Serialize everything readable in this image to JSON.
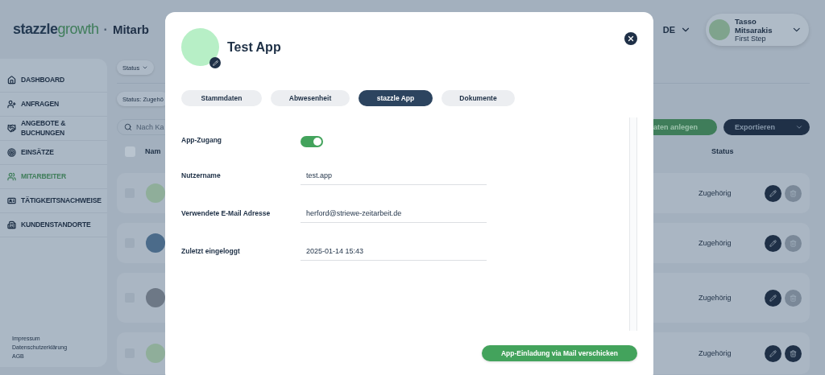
{
  "brand": {
    "name": "stazzle",
    "suffix": "growth"
  },
  "separator": "·",
  "page_title": "Mitarb",
  "language": "DE",
  "user": {
    "name": "Tasso Mitsarakis",
    "company": "First Step"
  },
  "sidebar": {
    "items": [
      {
        "label": "DASHBOARD",
        "selected": false
      },
      {
        "label": "ANFRAGEN",
        "selected": false
      },
      {
        "label": "ANGEBOTE & BUCHUNGEN",
        "selected": false
      },
      {
        "label": "EINSÄTZE",
        "selected": false
      },
      {
        "label": "MITARBEITER",
        "selected": true
      },
      {
        "label": "TÄTIGKEITSNACHWEISE",
        "selected": false
      },
      {
        "label": "KUNDENSTANDORTE",
        "selected": false
      }
    ],
    "footer_links": [
      "Impressum",
      "Datenschutzerklärung",
      "AGB"
    ]
  },
  "filters": {
    "chip": "Status",
    "active_filter": "Status: Zugehö"
  },
  "search": {
    "placeholder": "Nach Ka"
  },
  "actions": {
    "create": "aten anlegen",
    "export": "Exportieren"
  },
  "table": {
    "columns": [
      "Nam",
      "Status"
    ],
    "select_all_checked": false,
    "rows": [
      {
        "checked": false,
        "status": "Zugehörig",
        "delete_enabled": false
      },
      {
        "checked": false,
        "status": "Zugehörig",
        "delete_enabled": false
      },
      {
        "checked": false,
        "status": "Zugehörig",
        "delete_enabled": false
      },
      {
        "checked": false,
        "status": "Zugehörig",
        "delete_enabled": true
      }
    ]
  },
  "modal": {
    "title": "Test App",
    "tabs": [
      {
        "label": "Stammdaten",
        "selected": false
      },
      {
        "label": "Abwesenheit",
        "selected": false
      },
      {
        "label": "stazzle App",
        "selected": true
      },
      {
        "label": "Dokumente",
        "selected": false
      }
    ],
    "fields": [
      {
        "kind": "toggle",
        "label": "App-Zugang",
        "on": true
      },
      {
        "kind": "text",
        "label": "Nutzername",
        "value": "test.app"
      },
      {
        "kind": "text",
        "label": "Verwendete E-Mail Adresse",
        "value": "herford@striewe-zeitarbeit.de"
      },
      {
        "kind": "text",
        "label": "Zuletzt eingeloggt",
        "value": "2025-01-14 15:43"
      }
    ],
    "send_button": "App-Einladung via Mail verschicken"
  }
}
